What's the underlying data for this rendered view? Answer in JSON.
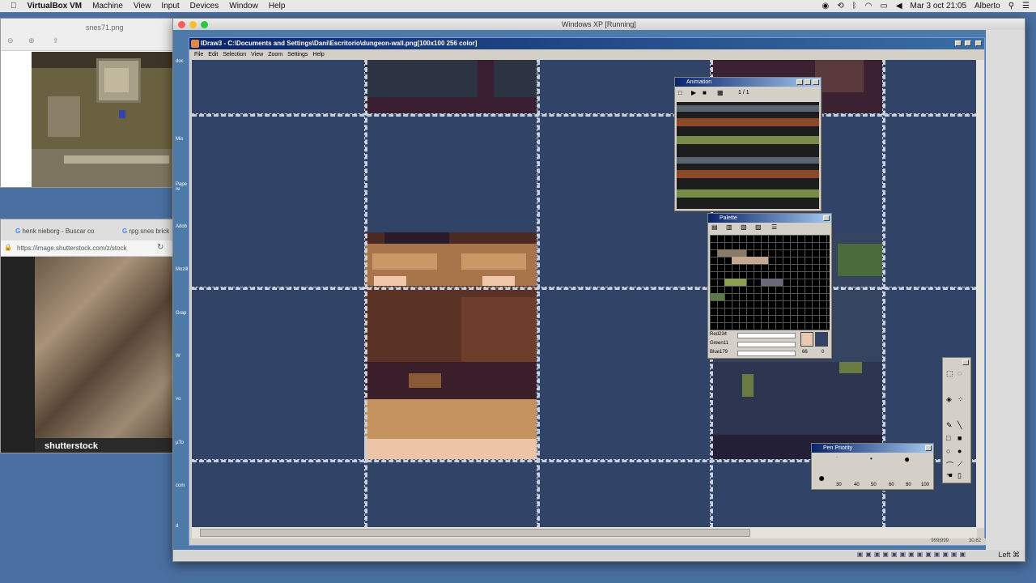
{
  "mac_menubar": {
    "apple_icon": "apple-icon",
    "app": "VirtualBox VM",
    "items": [
      "Machine",
      "View",
      "Input",
      "Devices",
      "Window",
      "Help"
    ],
    "datetime": "Mar 3 oct  21:05",
    "user": "Alberto"
  },
  "preview_window": {
    "filename": "snes71.png"
  },
  "browser_window": {
    "tabs": [
      {
        "label": "henk nieborg - Buscar co"
      },
      {
        "label": "rpg snes brick"
      }
    ],
    "url": "https://image.shutterstock.com/z/stock",
    "watermark": "shutterstock"
  },
  "vm_window": {
    "title": "Windows XP [Running]",
    "host_key": "Left ⌘"
  },
  "idraw": {
    "title": "IDraw3 - C:\\Documents and Settings\\Dani\\Escritorio\\dungeon-wall.png[100x100 256 color]",
    "menu": [
      "File",
      "Edit",
      "Selection",
      "View",
      "Zoom",
      "Settings",
      "Help"
    ],
    "status_left": "999|999",
    "status_right": "30,62"
  },
  "animation_window": {
    "title": "Animation",
    "frame": "1 / 1"
  },
  "palette_window": {
    "title": "Palette",
    "red_label": "Red234",
    "green_label": "Green11",
    "blue_label": "Blue179",
    "index_a": "66",
    "index_b": "0",
    "fg_color": "#eac9b3",
    "bg_color": "#314467"
  },
  "pen_window": {
    "title": "Pen Priority",
    "sizes": [
      "30",
      "40",
      "50",
      "60",
      "80",
      "100"
    ]
  },
  "desktop_icons": [
    "doc",
    "Mis",
    "Pape re",
    "Adob",
    "Mozill",
    "Grap",
    "W",
    "vo",
    "µTo",
    "com",
    "d"
  ]
}
